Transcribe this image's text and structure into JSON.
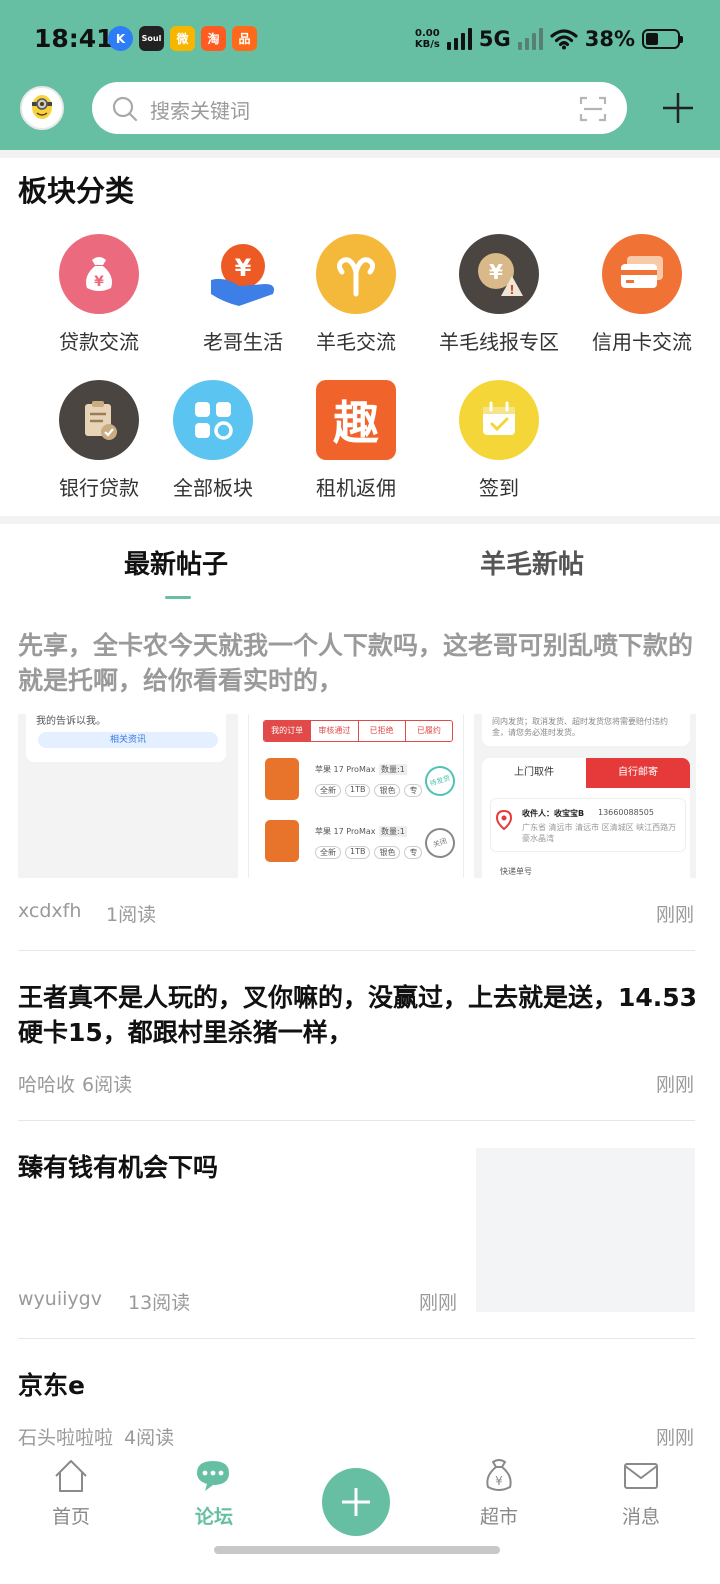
{
  "status_bar": {
    "time": "18:41",
    "net_speed_value": "0.00",
    "net_speed_unit": "KB/s",
    "network": "5G",
    "battery": "38%",
    "app_icons": [
      {
        "name": "k-app-icon",
        "glyph": "K",
        "color": "#2f7df6"
      },
      {
        "name": "soul-app-icon",
        "glyph": "Soul",
        "color": "#222222"
      },
      {
        "name": "weibo-icon",
        "glyph": "微",
        "color": "#f7b500"
      },
      {
        "name": "taobao-icon",
        "glyph": "淘",
        "color": "#ff5a1f"
      },
      {
        "name": "xiaohongshu-like-icon",
        "glyph": "品",
        "color": "#ff6a1a"
      }
    ]
  },
  "header": {
    "search_placeholder": "搜索关键词",
    "avatar_text": "小黄人"
  },
  "categories_section": {
    "title": "板块分类",
    "items": [
      {
        "label": "贷款交流",
        "icon": "money-bag-icon",
        "color": "#ec6a7d"
      },
      {
        "label": "老哥生活",
        "icon": "hand-coin-icon",
        "color": "#ee5a24"
      },
      {
        "label": "羊毛交流",
        "icon": "ram-icon",
        "color": "#f4b93a"
      },
      {
        "label": "羊毛线报专区",
        "icon": "coin-warning-icon",
        "color": "#4a4540"
      },
      {
        "label": "信用卡交流",
        "icon": "credit-card-icon",
        "color": "#f07234"
      },
      {
        "label": "银行贷款",
        "icon": "clipboard-check-icon",
        "color": "#4a4540"
      },
      {
        "label": "全部板块",
        "icon": "grid-icon",
        "color": "#5bc4f0"
      },
      {
        "label": "租机返佣",
        "icon": "qu-char-icon",
        "color": "#f0632a"
      },
      {
        "label": "签到",
        "icon": "calendar-check-icon",
        "color": "#f5d638"
      }
    ]
  },
  "tabs": [
    {
      "label": "最新帖子",
      "active": true
    },
    {
      "label": "羊毛新帖",
      "active": false
    }
  ],
  "posts": [
    {
      "title": "先享，全卡农今天就我一个人下款吗，这老哥可别乱喷下款的就是托啊，给你看看实时的，",
      "author": "xcdxfh",
      "reads": "1阅读",
      "time": "刚刚",
      "thumb1": {
        "text_top": "我的告诉以我。",
        "button": "相关资讯"
      },
      "thumb2": {
        "tabs": [
          "我的订单",
          "审核通过",
          "已拒绝",
          "已履约"
        ],
        "product": "苹果 17 ProMax",
        "qty": "数量:1",
        "tags": [
          "全新",
          "1TB",
          "银色",
          "专"
        ],
        "stamp1": "待发货",
        "stamp2": "关闭"
      },
      "thumb3": {
        "note": "间内发货；取消发货、超时发货您将需要赔付违约金，请您务必准时发货。",
        "tab_left": "上门取件",
        "tab_right": "自行邮寄",
        "receiver": "收件人：收宝宝B",
        "phone": "13660088505",
        "address": "广东省 清远市 清远市 区清城区 峡江西路万豪水晶湾",
        "express": "快递单号"
      }
    },
    {
      "title": "王者真不是人玩的，叉你嘛的，没赢过，上去就是送，14.53硬卡15，都跟村里杀猪一样，",
      "author": "哈哈收",
      "reads": "6阅读",
      "time": "刚刚"
    },
    {
      "title": "臻有钱有机会下吗",
      "author": "wyuiiygv",
      "reads": "13阅读",
      "time": "刚刚"
    },
    {
      "title": "京东e",
      "author": "石头啦啦啦",
      "reads": "4阅读",
      "time": "刚刚"
    }
  ],
  "bottom_nav": [
    {
      "label": "首页",
      "icon": "home-icon",
      "active": false
    },
    {
      "label": "论坛",
      "icon": "chat-bubble-icon",
      "active": true
    },
    {
      "label": "超市",
      "icon": "money-bag-outline-icon",
      "active": false
    },
    {
      "label": "消息",
      "icon": "envelope-icon",
      "active": false
    }
  ],
  "colors": {
    "brand": "#66bfa3",
    "active_nav": "#66bfa3",
    "text_muted": "#9a9a9a"
  }
}
